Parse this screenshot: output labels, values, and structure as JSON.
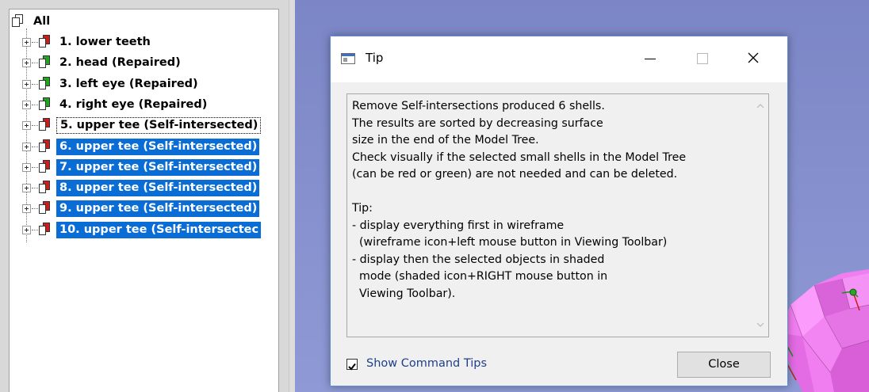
{
  "model_tree": {
    "root": {
      "label": "All",
      "icon": "shells-icon"
    },
    "items": [
      {
        "label": "1. lower teeth",
        "icon_color": "#c81e1e",
        "selected": false
      },
      {
        "label": "2. head (Repaired)",
        "icon_color": "#1fa51f",
        "selected": false
      },
      {
        "label": "3. left eye (Repaired)",
        "icon_color": "#1fa51f",
        "selected": false
      },
      {
        "label": "4. right eye (Repaired)",
        "icon_color": "#1fa51f",
        "selected": false
      },
      {
        "label": "5. upper tee (Self-intersected)",
        "icon_color": "#c81e1e",
        "selected": false,
        "focused": true
      },
      {
        "label": "6. upper tee (Self-intersected)",
        "icon_color": "#c81e1e",
        "selected": true
      },
      {
        "label": "7. upper tee (Self-intersected)",
        "icon_color": "#c81e1e",
        "selected": true
      },
      {
        "label": "8. upper tee (Self-intersected)",
        "icon_color": "#c81e1e",
        "selected": true
      },
      {
        "label": "9. upper tee (Self-intersected)",
        "icon_color": "#c81e1e",
        "selected": true
      },
      {
        "label": "10. upper tee (Self-intersectec",
        "icon_color": "#c81e1e",
        "selected": true
      }
    ]
  },
  "tip_dialog": {
    "title": "Tip",
    "title_icon": "window-icon",
    "controls": {
      "minimize": "minimize-icon",
      "maximize": "maximize-icon",
      "close": "close-icon"
    },
    "message": "Remove Self-intersections produced 6 shells.\nThe results are sorted by decreasing surface\nsize in the end of the Model Tree.\nCheck visually if the selected small shells in the Model Tree\n(can be red or green) are not needed and can be deleted.\n\nTip:\n- display everything first in wireframe\n  (wireframe icon+left mouse button in Viewing Toolbar)\n- display then the selected objects in shaded\n  mode (shaded icon+RIGHT mouse button in\n  Viewing Toolbar).",
    "show_tips_label": "Show Command Tips",
    "show_tips_checked": true,
    "close_label": "Close"
  },
  "colors": {
    "selection": "#0a6dd6",
    "viewport_background": "#8791cf",
    "model_mesh": "#f07ef0",
    "repaired_icon": "#1fa51f",
    "defective_icon": "#c81e1e"
  }
}
